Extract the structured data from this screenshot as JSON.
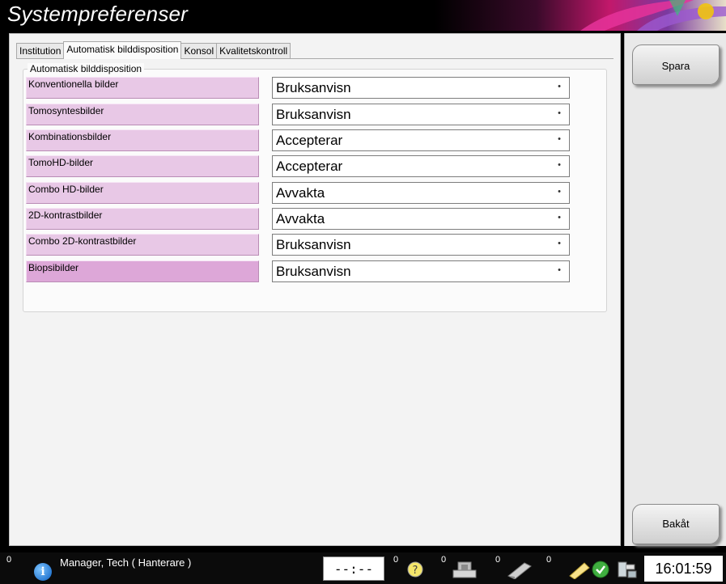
{
  "window": {
    "title": "Systempreferenser"
  },
  "tabs": [
    {
      "label": "Institution",
      "active": false
    },
    {
      "label": "Automatisk bilddisposition",
      "active": true
    },
    {
      "label": "Konsol",
      "active": false
    },
    {
      "label": "Kvalitetskontroll",
      "active": false
    }
  ],
  "group": {
    "legend": "Automatisk bilddisposition",
    "rows": [
      {
        "label": "Konventionella bilder",
        "value": "Bruksanvisn"
      },
      {
        "label": "Tomosyntesbilder",
        "value": "Bruksanvisn"
      },
      {
        "label": "Kombinationsbilder",
        "value": "Accepterar"
      },
      {
        "label": "TomoHD-bilder",
        "value": "Accepterar"
      },
      {
        "label": "Combo HD-bilder",
        "value": "Avvakta"
      },
      {
        "label": "2D-kontrastbilder",
        "value": "Avvakta"
      },
      {
        "label": "Combo 2D-kontrastbilder",
        "value": "Bruksanvisn"
      },
      {
        "label": "Biopsibilder",
        "value": "Bruksanvisn"
      }
    ]
  },
  "right_panel": {
    "save_label": "Spara",
    "back_label": "Bakåt"
  },
  "status": {
    "left_count": "0",
    "user": "Manager, Tech ( Hanterare )",
    "timer": "--:--",
    "counts": [
      "0",
      "0",
      "0",
      "0"
    ],
    "time": "16:01:59"
  },
  "icons": {
    "info": "info-icon",
    "help": "help-icon",
    "queue": "image-queue-icon",
    "printer": "printer-icon",
    "notes": "note-icon",
    "ok": "check-status-icon",
    "device": "device-icon"
  },
  "colors": {
    "label_bg": "#e8c8e6",
    "label_highlight": "#dda7d8",
    "panel_bg": "#f3f3f3"
  }
}
